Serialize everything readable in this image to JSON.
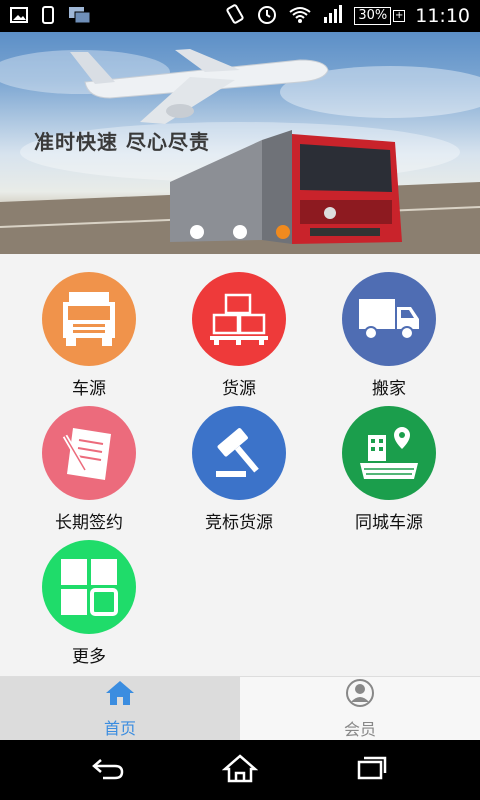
{
  "status_bar": {
    "time": "11:10",
    "battery_percent": "30%",
    "icons": [
      "image-icon",
      "phone-icon",
      "screens-icon",
      "vibrate-icon",
      "alarm-icon",
      "wifi-icon",
      "signal-icon",
      "battery-icon"
    ]
  },
  "banner": {
    "slogan": "准时快速  尽心尽责",
    "slides_count": 3,
    "active_slide_index": 2,
    "colors": {
      "active_dot": "#f08a1e",
      "dot": "#ffffff"
    }
  },
  "grid": {
    "items": [
      {
        "label": "车源",
        "icon": "truck-front-icon",
        "color": "#f0934b"
      },
      {
        "label": "货源",
        "icon": "cargo-boxes-icon",
        "color": "#ee3a3a"
      },
      {
        "label": "搬家",
        "icon": "moving-truck-icon",
        "color": "#4f6db3"
      },
      {
        "label": "长期签约",
        "icon": "contract-pen-icon",
        "color": "#ec6b7c"
      },
      {
        "label": "竞标货源",
        "icon": "auction-gavel-icon",
        "color": "#3c73c9"
      },
      {
        "label": "同城车源",
        "icon": "city-map-pin-icon",
        "color": "#1b9e4c"
      },
      {
        "label": "更多",
        "icon": "more-grid-icon",
        "color": "#1fdc6a"
      }
    ]
  },
  "tabbar": {
    "tabs": [
      {
        "label": "首页",
        "icon": "home-icon",
        "active": true,
        "color": "#3b8de0"
      },
      {
        "label": "会员",
        "icon": "member-icon",
        "active": false,
        "color": "#888888"
      }
    ]
  },
  "navbar": {
    "icons": [
      "back-icon",
      "home-nav-icon",
      "recents-icon"
    ]
  }
}
